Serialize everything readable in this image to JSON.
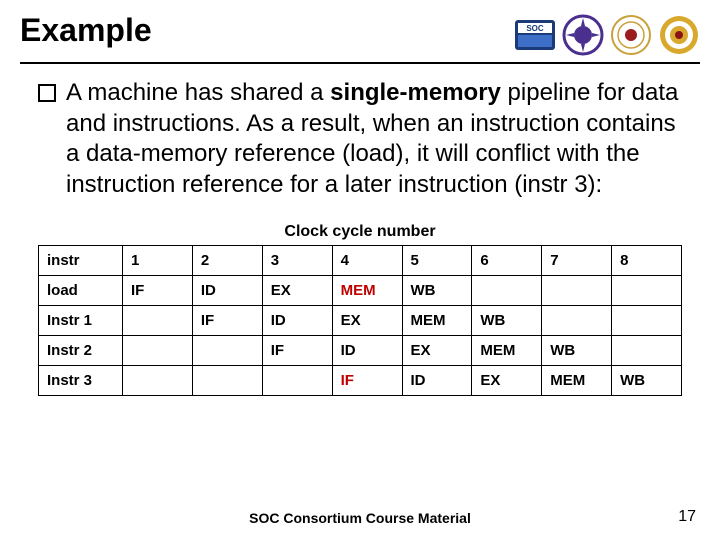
{
  "title": "Example",
  "logos": [
    "soc-consortium",
    "itri",
    "ncku",
    "ntu"
  ],
  "bullet": {
    "pre": "A machine has shared a ",
    "bold": "single-memory",
    "post": " pipeline for data and instructions. As a result, when an instruction contains a data-memory reference (load), it will conflict with the instruction reference for a later instruction (instr 3):"
  },
  "table": {
    "caption": "Clock cycle number",
    "cols": [
      "instr",
      "1",
      "2",
      "3",
      "4",
      "5",
      "6",
      "7",
      "8"
    ],
    "rows": [
      {
        "label": "load",
        "cells": [
          "IF",
          "ID",
          "EX",
          "MEM",
          "WB",
          "",
          "",
          ""
        ],
        "hilite": {
          "3": "mem"
        }
      },
      {
        "label": "Instr 1",
        "cells": [
          "",
          "IF",
          "ID",
          "EX",
          "MEM",
          "WB",
          "",
          ""
        ]
      },
      {
        "label": "Instr 2",
        "cells": [
          "",
          "",
          "IF",
          "ID",
          "EX",
          "MEM",
          "WB",
          ""
        ]
      },
      {
        "label": "Instr 3",
        "cells": [
          "",
          "",
          "",
          "IF",
          "ID",
          "EX",
          "MEM",
          "WB"
        ],
        "hilite": {
          "3": "if-hl"
        }
      }
    ]
  },
  "footer": "SOC Consortium Course Material",
  "page": "17"
}
